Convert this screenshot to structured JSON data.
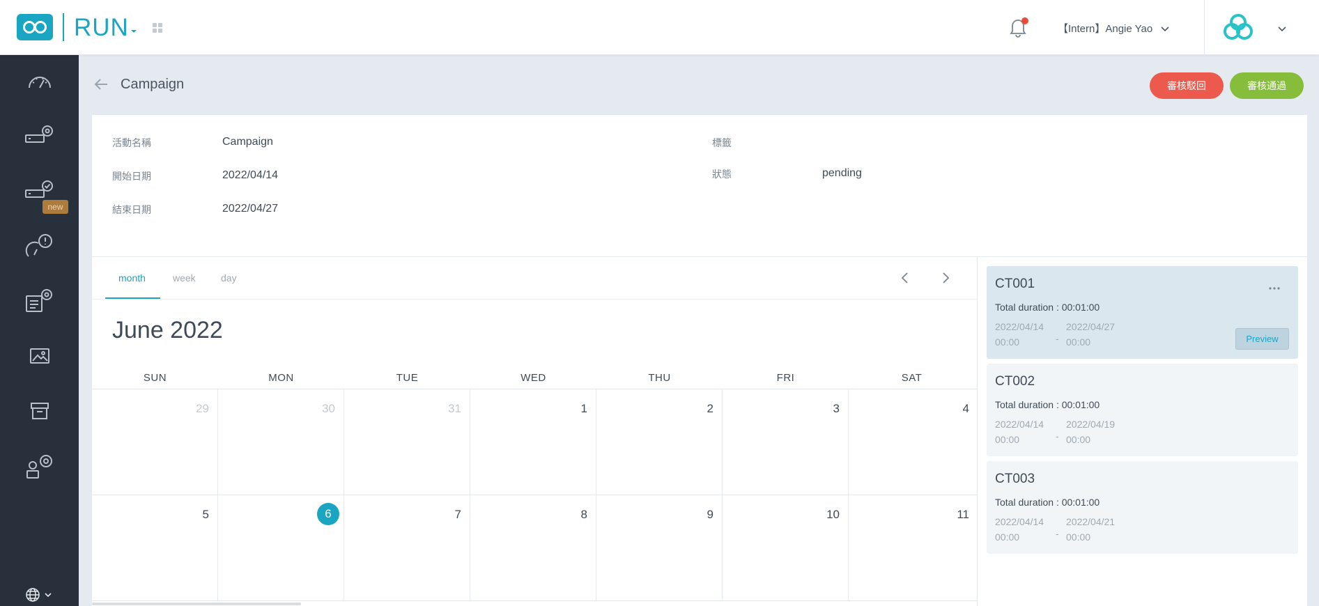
{
  "app": {
    "name": "RUN",
    "user_name": "【Intern】Angie Yao"
  },
  "colors": {
    "accent": "#1aa6c2",
    "sidebar_bg": "#27303b",
    "reject": "#eb5a4c",
    "approve": "#86bd3b",
    "notification_dot": "#e84b3c"
  },
  "sidebar": {
    "items": [
      {
        "icon": "dashboard-gauge-icon"
      },
      {
        "icon": "device-settings-icon"
      },
      {
        "icon": "device-check-icon",
        "badge": "new"
      },
      {
        "icon": "alert-gauge-icon"
      },
      {
        "icon": "content-settings-icon"
      },
      {
        "icon": "image-icon"
      },
      {
        "icon": "archive-icon"
      },
      {
        "icon": "user-settings-icon"
      }
    ],
    "language_icon": "globe-icon"
  },
  "page": {
    "title": "Campaign",
    "reject_label": "審核駁回",
    "approve_label": "審核通過"
  },
  "info": {
    "name_label": "活動名稱",
    "name_value": "Campaign",
    "start_label": "開始日期",
    "start_value": "2022/04/14",
    "end_label": "結束日期",
    "end_value": "2022/04/27",
    "tags_label": "標籤",
    "status_label": "狀態",
    "status_value": "pending"
  },
  "calendar": {
    "tabs": [
      "month",
      "week",
      "day"
    ],
    "active_tab": "month",
    "title": "June 2022",
    "weekdays": [
      "SUN",
      "MON",
      "TUE",
      "WED",
      "THU",
      "FRI",
      "SAT"
    ],
    "weeks": [
      [
        "29",
        "30",
        "31",
        "1",
        "2",
        "3",
        "4"
      ],
      [
        "5",
        "6",
        "7",
        "8",
        "9",
        "10",
        "11"
      ]
    ],
    "today": "6"
  },
  "campaign_items": [
    {
      "id": "CT001",
      "duration": "Total duration : 00:01:00",
      "start_date": "2022/04/14",
      "start_time": "00:00",
      "end_date": "2022/04/27",
      "end_time": "00:00",
      "selected": true,
      "preview_label": "Preview"
    },
    {
      "id": "CT002",
      "duration": "Total duration : 00:01:00",
      "start_date": "2022/04/14",
      "start_time": "00:00",
      "end_date": "2022/04/19",
      "end_time": "00:00",
      "selected": false
    },
    {
      "id": "CT003",
      "duration": "Total duration : 00:01:00",
      "start_date": "2022/04/14",
      "start_time": "00:00",
      "end_date": "2022/04/21",
      "end_time": "00:00",
      "selected": false
    }
  ],
  "date_separator": "-"
}
